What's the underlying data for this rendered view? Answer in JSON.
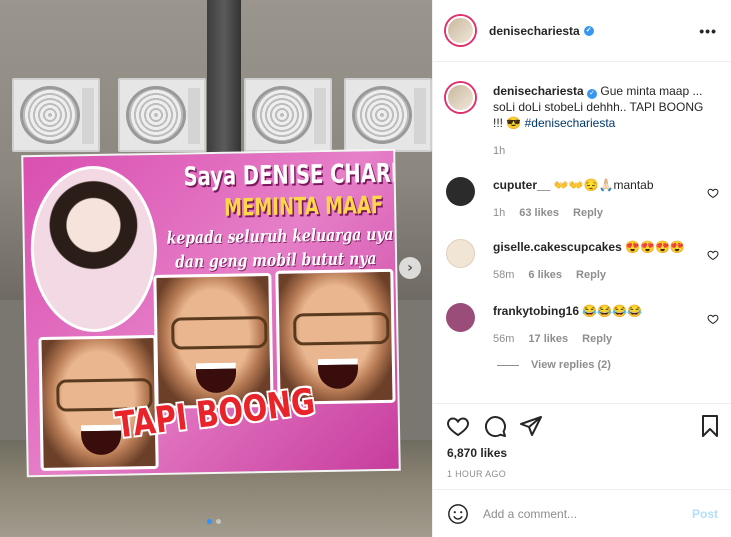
{
  "post": {
    "username": "denisechariesta",
    "verified": true,
    "more_label": "•••",
    "caption_text": "Gue minta maap ... soLi doLi stobeLi dehhh.. TAPI BOONG !!! 😎",
    "caption_tag": "#denisechariesta",
    "caption_time": "1h",
    "likes": "6,870 likes",
    "timestamp": "1 HOUR AGO"
  },
  "banner": {
    "line1": "Saya DENISE CHARIESTA",
    "line2": "MEMINTA MAAF",
    "line3": "kepada seluruh keluarga uya kuya",
    "line4": "dan geng mobil butut nya",
    "footer": "TAPI BOONG"
  },
  "carousel": {
    "next_icon": "›",
    "total": 2,
    "active": 1
  },
  "comments": [
    {
      "user": "cuputer__",
      "text": "👐👐😔🙏🏻mantab",
      "time": "1h",
      "likes": "63 likes",
      "reply": "Reply",
      "avatar_color": "#2b2b2b"
    },
    {
      "user": "giselle.cakescupcakes",
      "text": "😍😍😍😍",
      "time": "58m",
      "likes": "6 likes",
      "reply": "Reply",
      "avatar_color": "#f1e6d6"
    },
    {
      "user": "frankytobing16",
      "text": "😂😂😂😂",
      "time": "56m",
      "likes": "17 likes",
      "reply": "Reply",
      "avatar_color": "#9b4d7a"
    }
  ],
  "view_replies": "View replies (2)",
  "composer": {
    "placeholder": "Add a comment...",
    "post_label": "Post"
  }
}
